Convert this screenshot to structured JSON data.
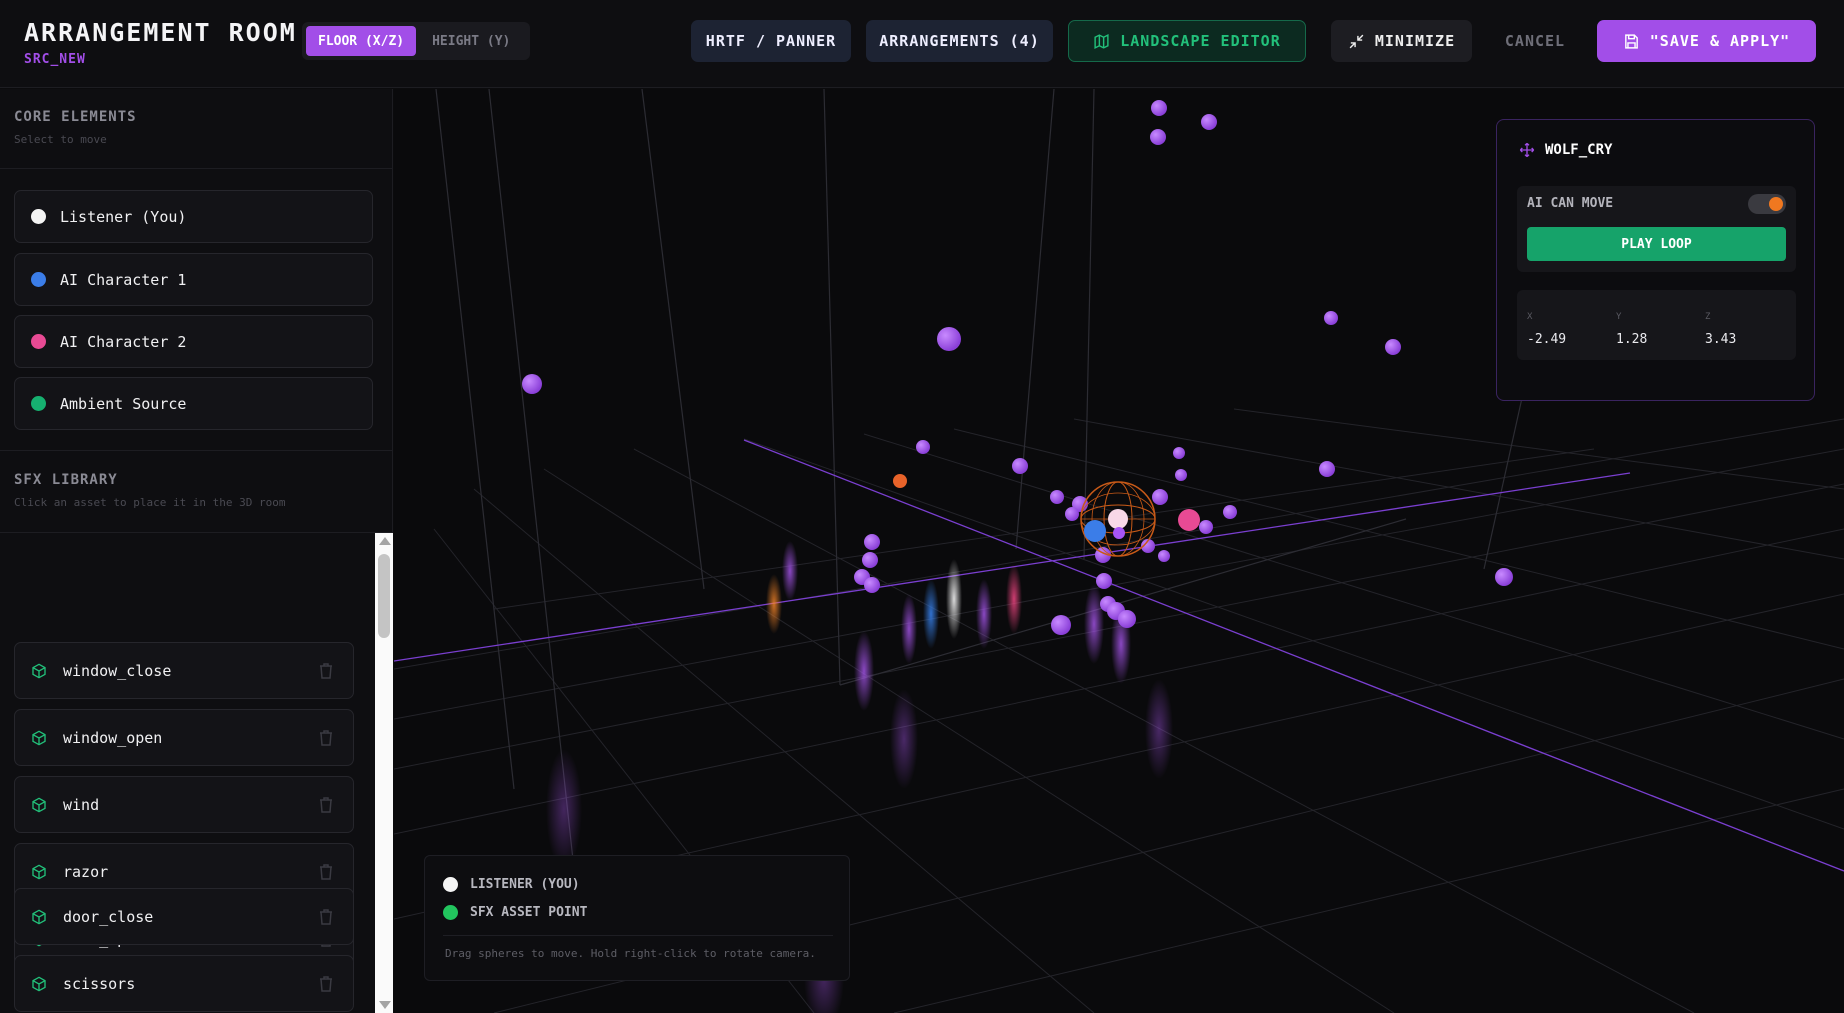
{
  "header": {
    "title": "ARRANGEMENT ROOM",
    "subtitle": "SRC_NEW",
    "mode_floor": "FLOOR (X/Z)",
    "mode_height": "HEIGHT (Y)",
    "hrtf": "HRTF / PANNER",
    "arrangements": "ARRANGEMENTS (4)",
    "landscape": "LANDSCAPE EDITOR",
    "minimize": "MINIMIZE",
    "cancel": "CANCEL",
    "save": "\"SAVE & APPLY\""
  },
  "sidebar": {
    "core_title": "CORE ELEMENTS",
    "core_sub": "Select to move",
    "core_items": [
      {
        "label": "Listener (You)",
        "color": "#f4f4f4"
      },
      {
        "label": "AI Character 1",
        "color": "#3b7de8"
      },
      {
        "label": "AI Character 2",
        "color": "#e84a94"
      },
      {
        "label": "Ambient Source",
        "color": "#16b070"
      }
    ],
    "sfx_title": "SFX LIBRARY",
    "sfx_sub": "Click an asset to place it in the 3D room",
    "sfx_items": [
      "window_close",
      "window_open",
      "wind",
      "razor",
      "door_open",
      "door_close",
      "scissors"
    ]
  },
  "inspector": {
    "name": "WOLF_CRY",
    "ai_can_move": "AI CAN MOVE",
    "play_loop": "PLAY LOOP",
    "x_label": "X",
    "y_label": "Y",
    "z_label": "Z",
    "x_value": "-2.49",
    "y_value": "1.28",
    "z_value": "3.43"
  },
  "legend": {
    "listener": "LISTENER (YOU)",
    "sfx_point": "SFX ASSET POINT",
    "hint": "Drag spheres to move. Hold right-click to rotate camera."
  },
  "colors": {
    "accent": "#a24ee8",
    "green": "#16a36a",
    "orange": "#f07820",
    "sfx_sphere": "#a855f7"
  }
}
